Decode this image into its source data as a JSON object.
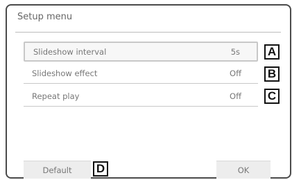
{
  "menu": {
    "title": "Setup menu",
    "rows": [
      {
        "label": "Slideshow interval",
        "value": "5s",
        "marker": "A"
      },
      {
        "label": "Slideshow effect",
        "value": "Off",
        "marker": "B"
      },
      {
        "label": "Repeat play",
        "value": "Off",
        "marker": "C"
      }
    ]
  },
  "buttons": {
    "default_label": "Default",
    "default_marker": "D",
    "ok_label": "OK"
  }
}
